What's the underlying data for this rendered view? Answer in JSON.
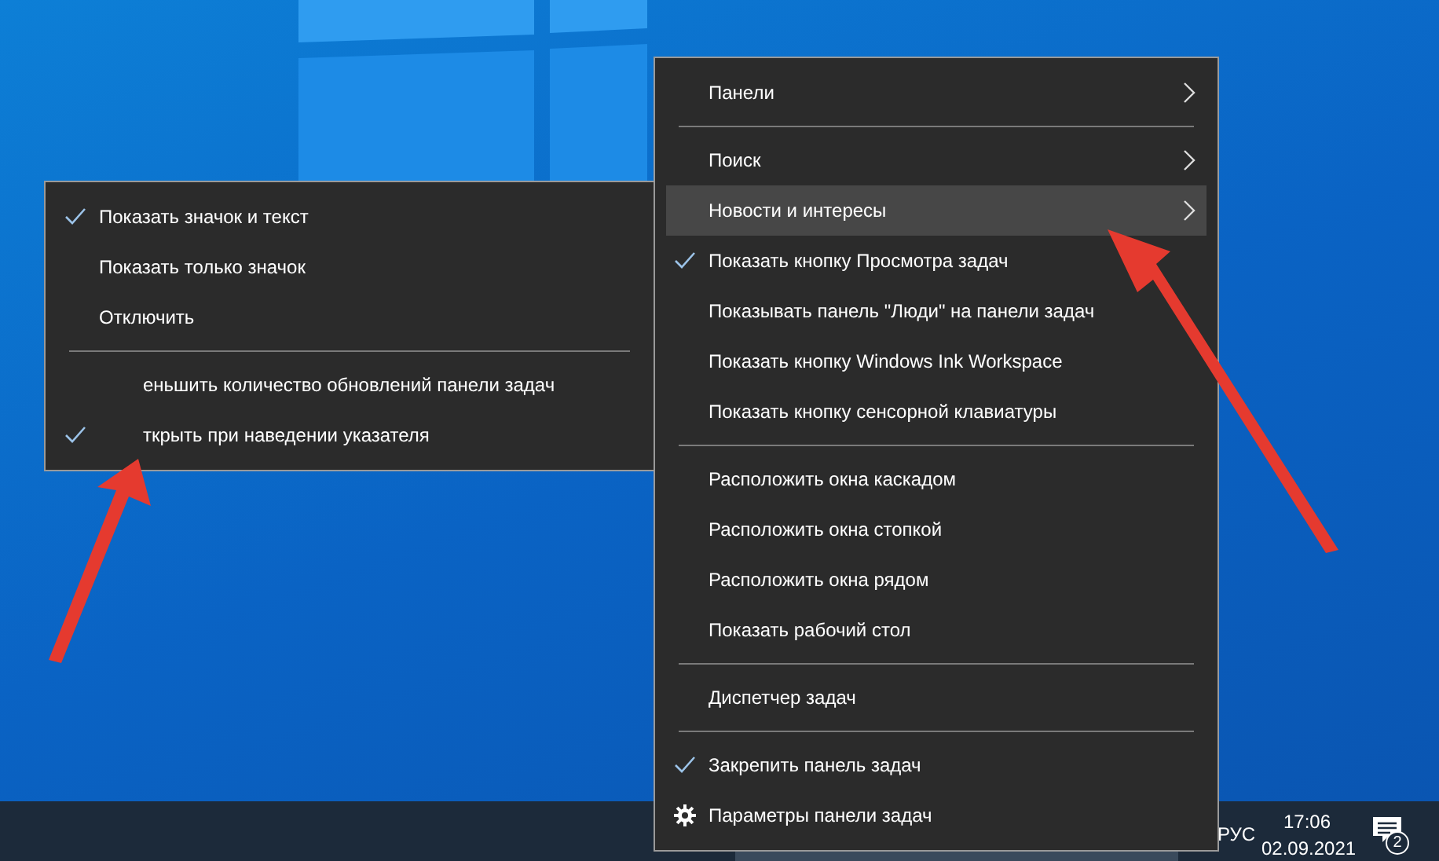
{
  "context_menu": {
    "items": [
      {
        "kind": "item",
        "label": "Панели",
        "checked": false,
        "submenu": true,
        "selected": false
      },
      {
        "kind": "separator"
      },
      {
        "kind": "item",
        "label": "Поиск",
        "checked": false,
        "submenu": true,
        "selected": false
      },
      {
        "kind": "item",
        "label": "Новости и интересы",
        "checked": false,
        "submenu": true,
        "selected": true
      },
      {
        "kind": "item",
        "label": "Показать кнопку Просмотра задач",
        "checked": true,
        "submenu": false,
        "selected": false
      },
      {
        "kind": "item",
        "label": "Показывать панель \"Люди\" на панели задач",
        "checked": false,
        "submenu": false,
        "selected": false
      },
      {
        "kind": "item",
        "label": "Показать кнопку Windows Ink Workspace",
        "checked": false,
        "submenu": false,
        "selected": false
      },
      {
        "kind": "item",
        "label": "Показать кнопку сенсорной клавиатуры",
        "checked": false,
        "submenu": false,
        "selected": false
      },
      {
        "kind": "separator"
      },
      {
        "kind": "item",
        "label": "Расположить окна каскадом",
        "checked": false,
        "submenu": false,
        "selected": false
      },
      {
        "kind": "item",
        "label": "Расположить окна стопкой",
        "checked": false,
        "submenu": false,
        "selected": false
      },
      {
        "kind": "item",
        "label": "Расположить окна рядом",
        "checked": false,
        "submenu": false,
        "selected": false
      },
      {
        "kind": "item",
        "label": "Показать рабочий стол",
        "checked": false,
        "submenu": false,
        "selected": false
      },
      {
        "kind": "separator"
      },
      {
        "kind": "item",
        "label": "Диспетчер задач",
        "checked": false,
        "submenu": false,
        "selected": false
      },
      {
        "kind": "separator"
      },
      {
        "kind": "item",
        "label": "Закрепить панель задач",
        "checked": true,
        "submenu": false,
        "selected": false
      },
      {
        "kind": "settings",
        "label": "Параметры панели задач",
        "submenu": false,
        "selected": false
      }
    ]
  },
  "submenu": {
    "items": [
      {
        "kind": "item",
        "label": "Показать значок и текст",
        "checked": true,
        "covered": false
      },
      {
        "kind": "item",
        "label": "Показать только значок",
        "checked": false,
        "covered": false
      },
      {
        "kind": "item",
        "label": "Отключить",
        "checked": false,
        "covered": false
      },
      {
        "kind": "separator"
      },
      {
        "kind": "item",
        "label": "еньшить количество обновлений панели задач",
        "checked": false,
        "covered": true
      },
      {
        "kind": "item",
        "label": "ткрыть при наведении указателя",
        "checked": true,
        "covered": true
      }
    ]
  },
  "taskbar": {
    "language": "РУС",
    "time": "17:06",
    "date": "02.09.2021",
    "notification_count": "2"
  }
}
